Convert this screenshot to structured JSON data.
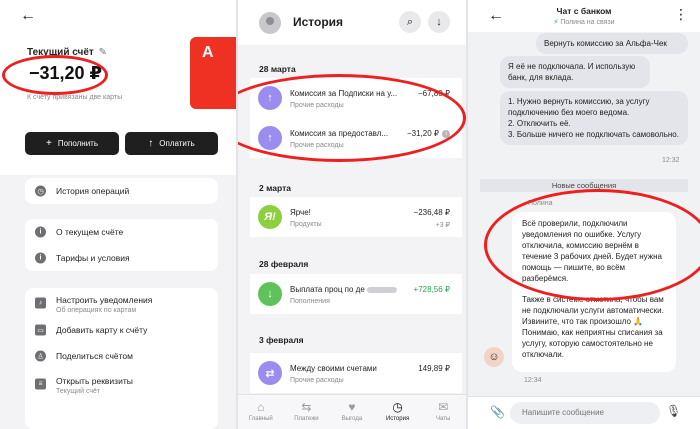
{
  "panel1": {
    "back_icon": "arrow-left-icon",
    "account_title": "Текущий счёт",
    "balance": "−31,20 ₽",
    "subtitle": "К счету привязаны две карты",
    "card_logo": "А",
    "buttons": {
      "topup": "Пополнить",
      "pay": "Оплатить"
    },
    "history": "История операций",
    "about": "О текущем счёте",
    "tariffs": "Тарифы и условия",
    "notify": {
      "label": "Настроить уведомления",
      "sub": "Об операциях по картам"
    },
    "add_card": "Добавить карту к счёту",
    "share": "Поделиться счётом",
    "details": {
      "label": "Открыть реквизиты",
      "sub": "Текущий счёт"
    }
  },
  "panel2": {
    "title": "История",
    "groups": [
      {
        "date": "28 марта",
        "items": [
          {
            "name": "Комиссия за Подписки на у...",
            "category": "Прочие расходы",
            "amount": "−67,80 ₽"
          },
          {
            "name": "Комиссия за предоставл...",
            "category": "Прочие расходы",
            "amount": "−31,20 ₽"
          }
        ]
      },
      {
        "date": "2 марта",
        "items": [
          {
            "name": "Ярче!",
            "category": "Продукты",
            "amount": "−236,48 ₽",
            "sub": "+3 ₽"
          }
        ]
      },
      {
        "date": "28 февраля",
        "items": [
          {
            "name": "Выплата проц по де",
            "category": "Пополнения",
            "amount": "+728,56 ₽"
          }
        ]
      },
      {
        "date": "3 февраля",
        "items": [
          {
            "name": "Между своими счетами",
            "category": "Прочие расходы",
            "amount": "149,89 ₽"
          }
        ]
      }
    ],
    "tabs": [
      "Главный",
      "Платежи",
      "Выгода",
      "История",
      "Чаты"
    ]
  },
  "panel3": {
    "title": "Чат с банком",
    "status": "Полина на связи",
    "msg1": "Вернуть комиссию за Альфа-Чек",
    "msg2": "Я её не подключала. И использую банк, для вклада.",
    "msg3": "1. Нужно вернуть комиссию, за услугу подключению без моего ведома.\n2. Отключить её.\n3. Больше ничего не подключать самовольно.",
    "time1": "12:32",
    "new_messages": "Новые сообщения",
    "sender": "Полина",
    "reply_p1": "Всё проверили, подключили уведомления по ошибке. Услугу отключила, комиссию вернём в течение 3 рабочих дней. Будет нужна помощь — пишите, во всём разберёмся.",
    "reply_p2": "Также в системе отметила, чтобы вам не подключали услуги автоматически. Извините, что так произошло 🙏 Понимаю, как неприятны списания за услугу, которую самостоятельно не отключали.",
    "time2": "12:34",
    "input_placeholder": "Напишите сообщение"
  },
  "colors": {
    "accent_red": "#ef3124",
    "annotation_red": "#ef1f1f",
    "green": "#2aa54a",
    "purple": "#9b8cf0",
    "dark_button": "#1f1f1f"
  }
}
